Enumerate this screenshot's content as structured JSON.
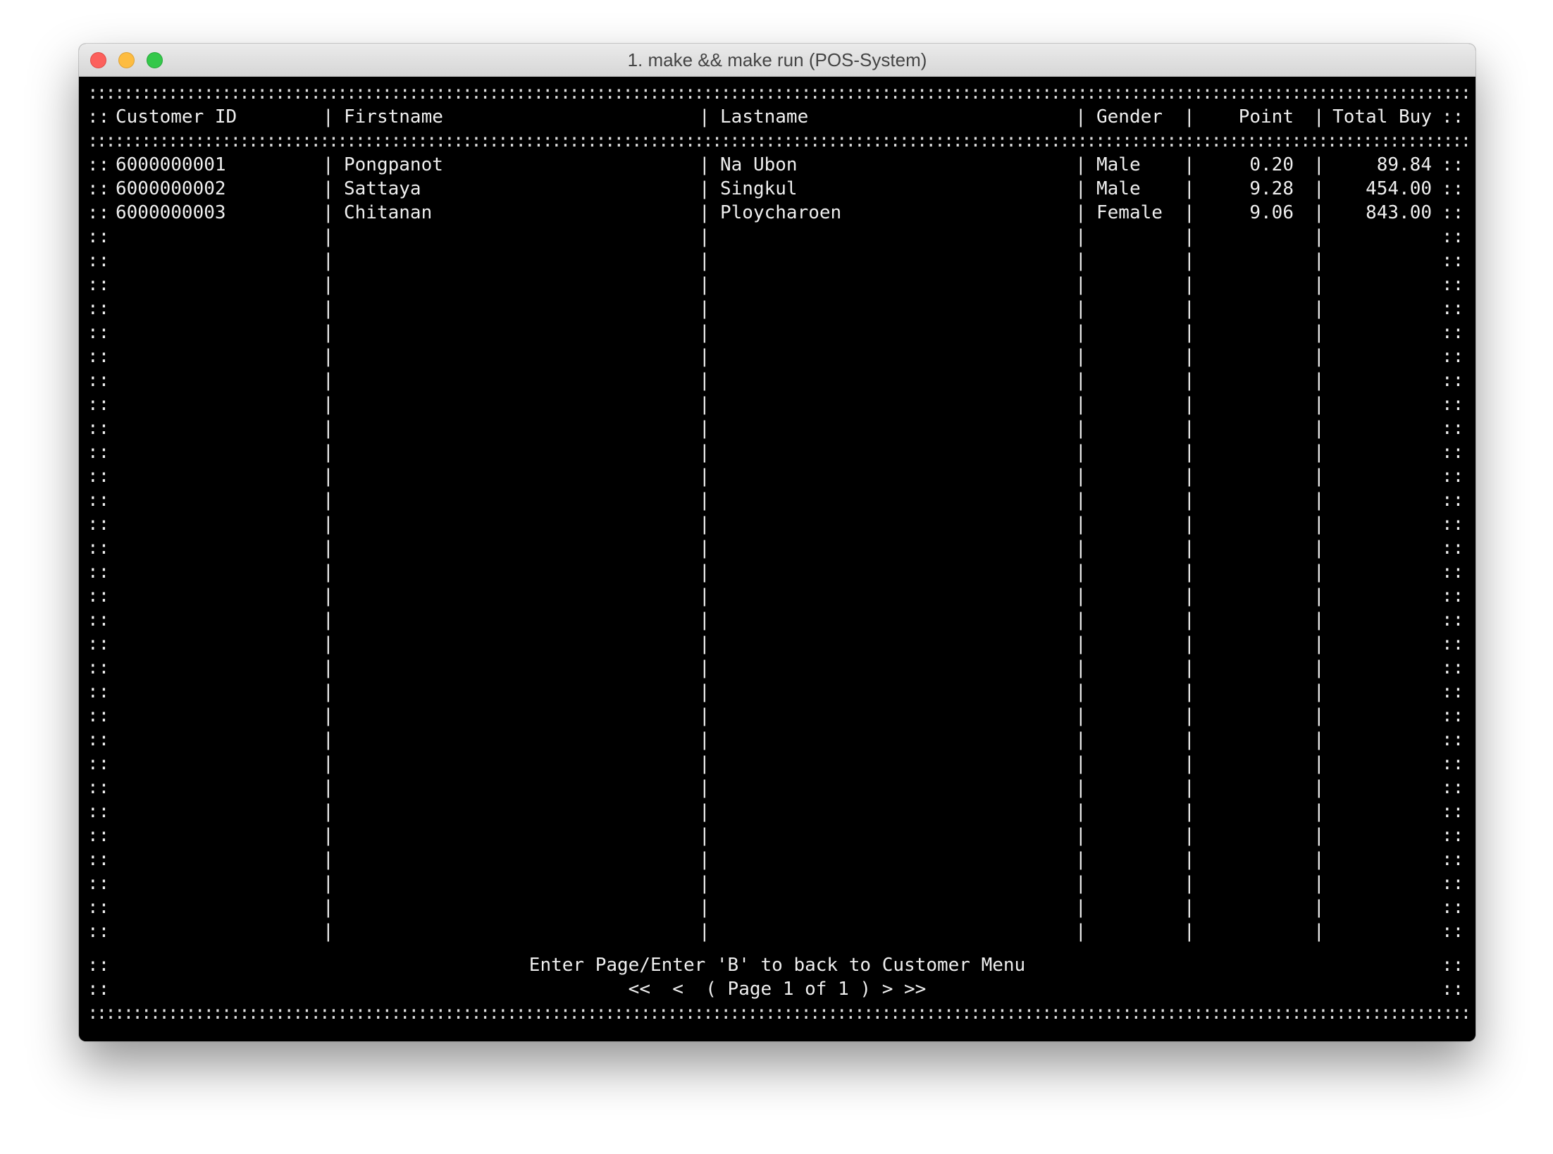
{
  "window": {
    "title": "1. make && make run (POS-System)"
  },
  "table": {
    "headers": {
      "customer_id": "Customer ID",
      "firstname": "Firstname",
      "lastname": "Lastname",
      "gender": "Gender",
      "point": "Point",
      "total_buy": "Total Buy"
    },
    "rows": [
      {
        "customer_id": "6000000001",
        "firstname": "Pongpanot",
        "lastname": "Na Ubon",
        "gender": "Male",
        "point": "0.20",
        "total_buy": "89.84"
      },
      {
        "customer_id": "6000000002",
        "firstname": "Sattaya",
        "lastname": "Singkul",
        "gender": "Male",
        "point": "9.28",
        "total_buy": "454.00"
      },
      {
        "customer_id": "6000000003",
        "firstname": "Chitanan",
        "lastname": "Ploycharoen",
        "gender": "Female",
        "point": "9.06",
        "total_buy": "843.00"
      }
    ],
    "border_left": "::",
    "border_right": "::",
    "separator": "|",
    "rule": "::::::::::::::::::::::::::::::::::::::::::::::::::::::::::::::::::::::::::::::::::::::::::::::::::::::::::::::::::::::::::::::::::::::::::::::::::::::::::::::::::::::::::::::::::::::::::::::::::::::::::::::"
  },
  "footer": {
    "instruction": "Enter Page/Enter 'B' to back to Customer Menu",
    "pager": "<<  <  ( Page 1 of 1 ) > >>"
  },
  "prompt": {
    "symbol": ">>>"
  }
}
